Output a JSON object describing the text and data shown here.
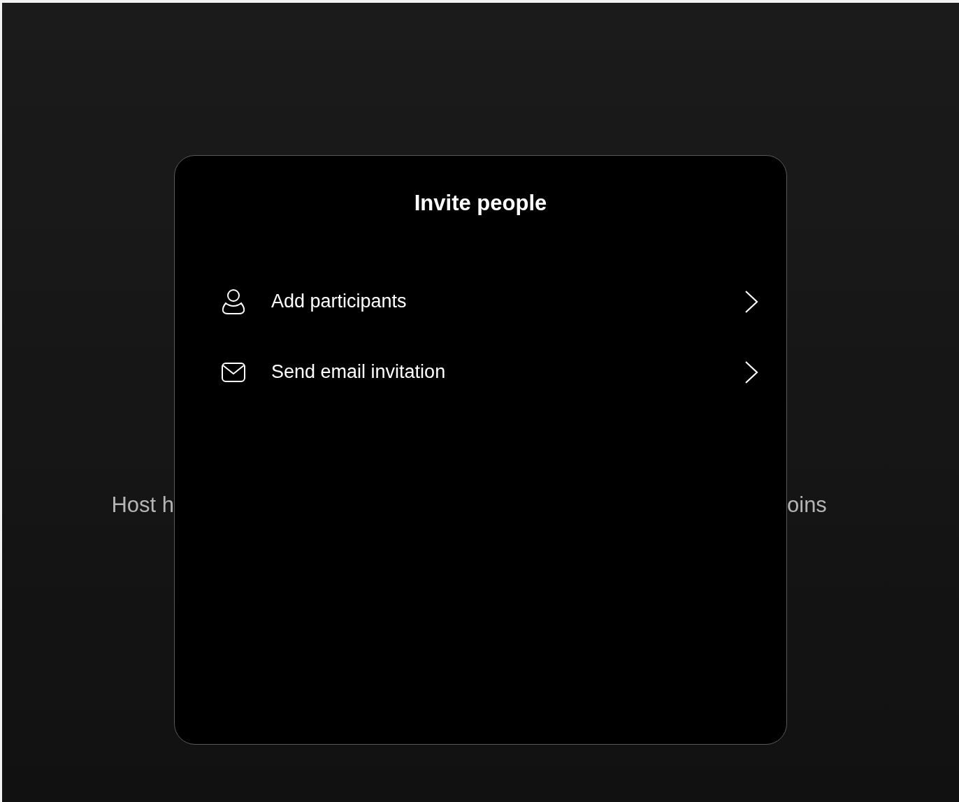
{
  "background_message": {
    "left_visible": "Host h",
    "right_visible": "oins"
  },
  "dialog": {
    "title": "Invite people",
    "items": [
      {
        "kind": "person",
        "label": "Add participants"
      },
      {
        "kind": "mail",
        "label": "Send email invitation"
      }
    ]
  }
}
